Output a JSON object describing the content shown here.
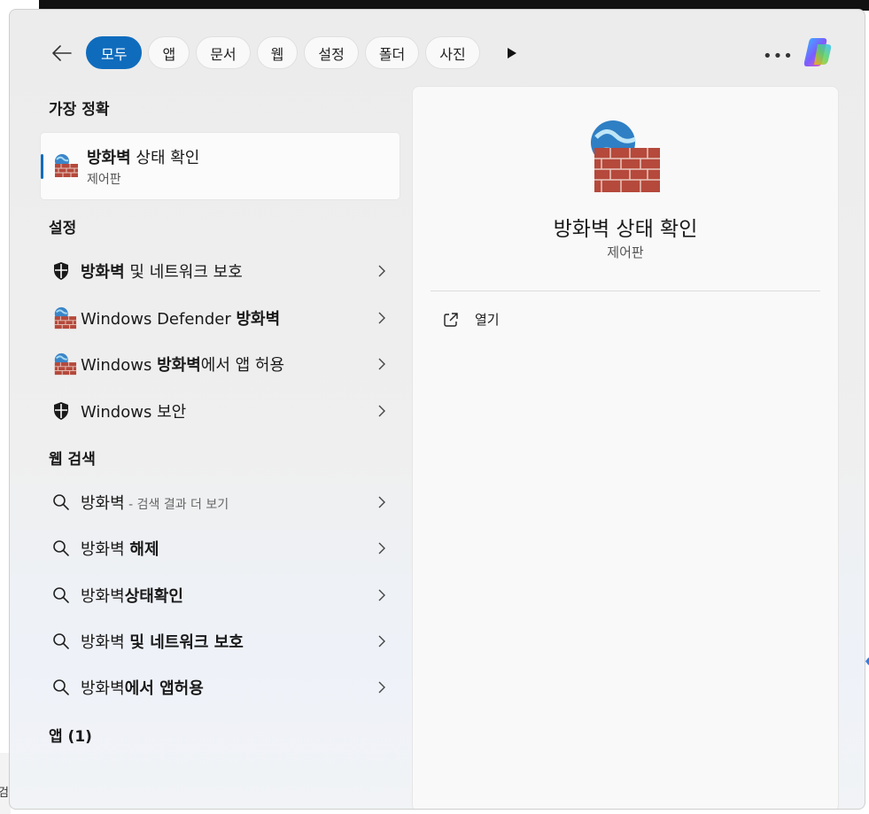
{
  "filters": [
    "모두",
    "앱",
    "문서",
    "웹",
    "설정",
    "폴더",
    "사진"
  ],
  "sections": {
    "best": "가장 정확",
    "settings": "설정",
    "web": "웹 검색",
    "apps": "앱 (1)"
  },
  "best_match": {
    "title_bold": "방화벽",
    "title_rest": " 상태 확인",
    "subtitle": "제어판"
  },
  "settings_items": [
    {
      "icon": "shield-icon",
      "parts": [
        {
          "b": "방화벽"
        },
        {
          "t": " 및 네트워크 보호"
        }
      ]
    },
    {
      "icon": "firewall-icon",
      "parts": [
        {
          "t": "Windows Defender "
        },
        {
          "b": "방화벽"
        }
      ]
    },
    {
      "icon": "firewall-icon",
      "parts": [
        {
          "t": "Windows "
        },
        {
          "b": "방화벽"
        },
        {
          "t": "에서 앱 허용"
        }
      ]
    },
    {
      "icon": "shield-icon",
      "parts": [
        {
          "t": "Windows 보안"
        }
      ]
    }
  ],
  "web_items": [
    {
      "parts": [
        {
          "t": "방화벽"
        },
        {
          "l": " - 검색 결과 더 보기"
        }
      ]
    },
    {
      "parts": [
        {
          "t": "방화벽 "
        },
        {
          "b": "해제"
        }
      ]
    },
    {
      "parts": [
        {
          "t": "방화벽"
        },
        {
          "b": "상태확인"
        }
      ]
    },
    {
      "parts": [
        {
          "t": "방화벽 "
        },
        {
          "b": "및 네트워크 보호"
        }
      ]
    },
    {
      "parts": [
        {
          "t": "방화벽"
        },
        {
          "b": "에서 앱허용"
        }
      ]
    }
  ],
  "details": {
    "title": "방화벽 상태 확인",
    "subtitle": "제어판",
    "open_label": "열기"
  },
  "taskbar_fragment": "검",
  "colors": {
    "accent": "#0f6cbd"
  }
}
